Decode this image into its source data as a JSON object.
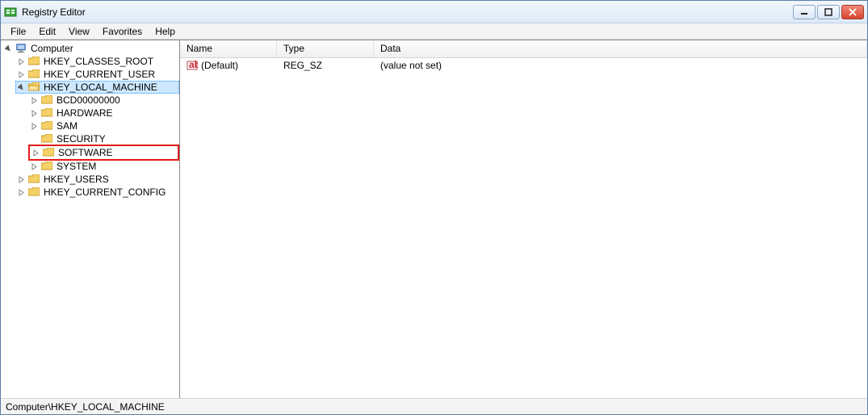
{
  "window": {
    "title": "Registry Editor"
  },
  "menu": {
    "file": "File",
    "edit": "Edit",
    "view": "View",
    "favorites": "Favorites",
    "help": "Help"
  },
  "tree": {
    "root": "Computer",
    "hkcr": "HKEY_CLASSES_ROOT",
    "hkcu": "HKEY_CURRENT_USER",
    "hklm": "HKEY_LOCAL_MACHINE",
    "hklm_children": {
      "bcd": "BCD00000000",
      "hardware": "HARDWARE",
      "sam": "SAM",
      "security": "SECURITY",
      "software": "SOFTWARE",
      "system": "SYSTEM"
    },
    "hku": "HKEY_USERS",
    "hkcc": "HKEY_CURRENT_CONFIG"
  },
  "columns": {
    "name": "Name",
    "type": "Type",
    "data": "Data"
  },
  "values": [
    {
      "name": "(Default)",
      "type": "REG_SZ",
      "data": "(value not set)"
    }
  ],
  "status": "Computer\\HKEY_LOCAL_MACHINE"
}
